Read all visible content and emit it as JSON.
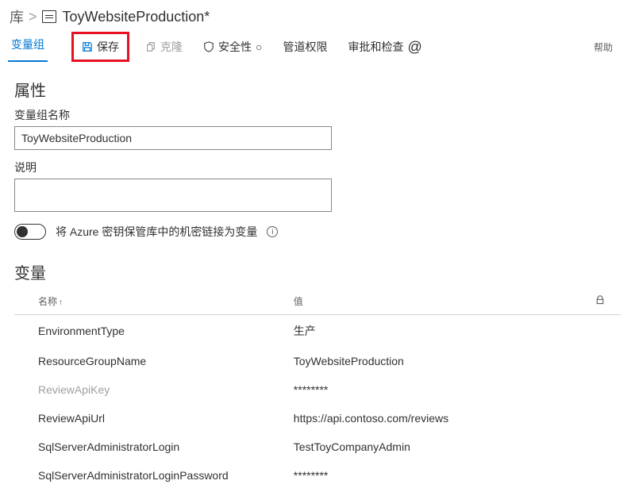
{
  "breadcrumb": {
    "root": "库",
    "sep": ">",
    "title": "ToyWebsiteProduction*"
  },
  "tabs": {
    "variable_groups": "变量组"
  },
  "commands": {
    "save": "保存",
    "clone": "克隆",
    "security": "安全性",
    "pipeline_perms": "管道权限",
    "approvals": "审批和检查",
    "help": "帮助"
  },
  "icons": {
    "security_circle": "○",
    "refresh_glyph": "↻",
    "at": "@"
  },
  "properties": {
    "heading": "属性",
    "name_label": "变量组名称",
    "name_value": "ToyWebsiteProduction",
    "desc_label": "说明",
    "desc_value": "",
    "kv_link_label": "将 Azure 密钥保管库中的机密链接为变量",
    "info": "i"
  },
  "variables": {
    "heading": "变量",
    "columns": {
      "name": "名称",
      "name_sort": "↑",
      "value": "值"
    },
    "rows": [
      {
        "name": "EnvironmentType",
        "value": "生产",
        "locked": false
      },
      {
        "name": "ResourceGroupName",
        "value": "ToyWebsiteProduction",
        "locked": false
      },
      {
        "name": "ReviewApiKey",
        "value": "********",
        "locked": true
      },
      {
        "name": "ReviewApiUrl",
        "value": "https://api.contoso.com/reviews",
        "locked": false
      },
      {
        "name": "SqlServerAdministratorLogin",
        "value": "TestToyCompanyAdmin",
        "locked": false
      },
      {
        "name": "SqlServerAdministratorLoginPassword",
        "value": "********",
        "locked": false
      }
    ]
  }
}
